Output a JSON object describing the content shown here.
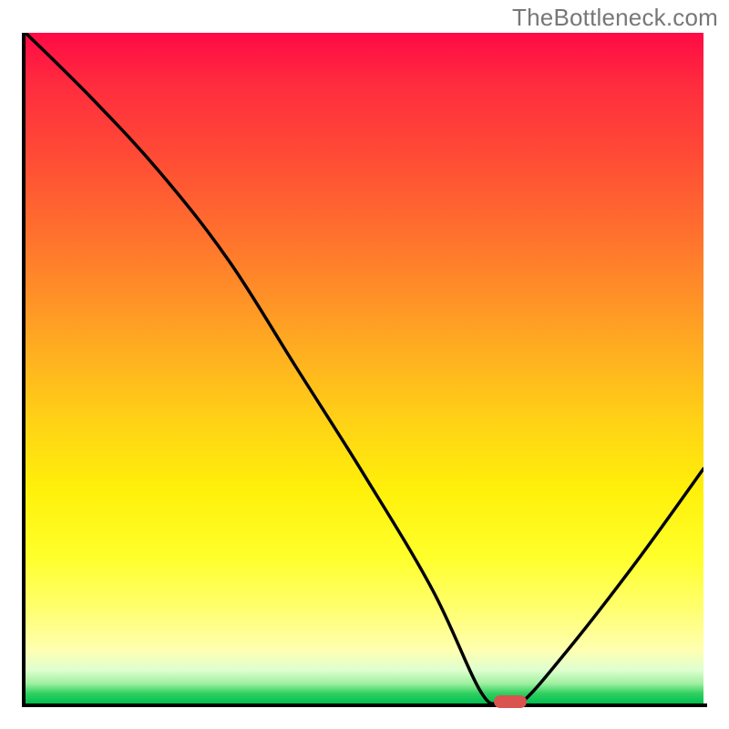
{
  "watermark": "TheBottleneck.com",
  "chart_data": {
    "type": "line",
    "title": "",
    "xlabel": "",
    "ylabel": "",
    "xlim": [
      0,
      100
    ],
    "ylim": [
      0,
      100
    ],
    "grid": false,
    "legend": false,
    "x": [
      0,
      10,
      20,
      30,
      40,
      50,
      60,
      67,
      70,
      73,
      80,
      90,
      100
    ],
    "values": [
      100,
      90,
      79,
      66,
      50,
      34,
      17,
      2,
      0,
      0,
      8,
      21,
      35
    ],
    "marker": {
      "x": 71.5,
      "y": 0,
      "color": "#d9534f"
    },
    "background_gradient": {
      "direction": "vertical",
      "stops": [
        {
          "pos": 0.0,
          "color": "#ff0a45"
        },
        {
          "pos": 0.5,
          "color": "#ffb020"
        },
        {
          "pos": 0.8,
          "color": "#ffff40"
        },
        {
          "pos": 0.95,
          "color": "#dfffd0"
        },
        {
          "pos": 1.0,
          "color": "#00c050"
        }
      ]
    }
  }
}
